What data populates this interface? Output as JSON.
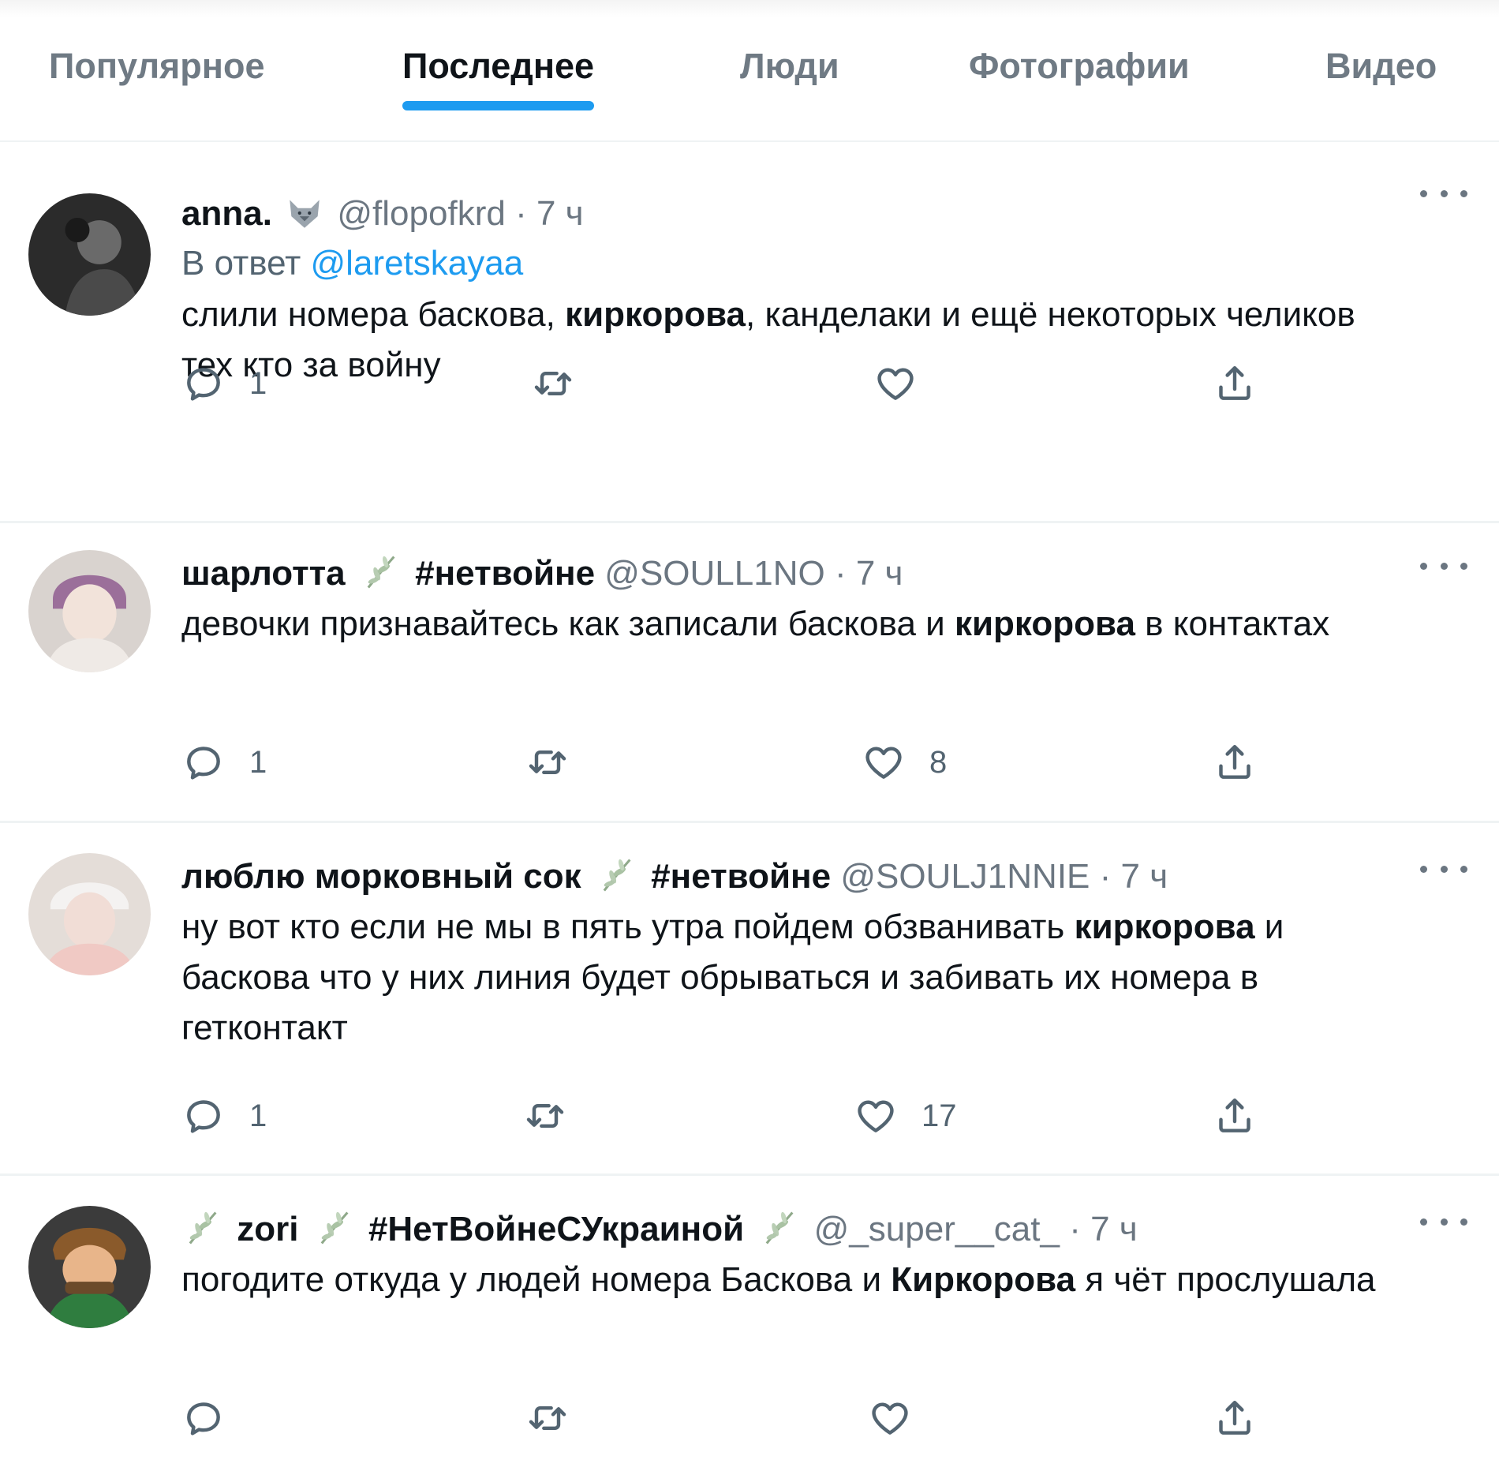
{
  "tabs": [
    {
      "label": "Популярное",
      "active": false
    },
    {
      "label": "Последнее",
      "active": true
    },
    {
      "label": "Люди",
      "active": false
    },
    {
      "label": "Фотографии",
      "active": false
    },
    {
      "label": "Видео",
      "active": false
    }
  ],
  "colors": {
    "accent": "#1d9bf0",
    "secondary_text": "#536471",
    "primary_text": "#0f1419",
    "divider": "#eff3f4"
  },
  "icons": {
    "reply": "reply-icon",
    "retweet": "retweet-icon",
    "like": "heart-icon",
    "share": "share-icon",
    "more": "more-icon",
    "plant": "plant-icon",
    "fox": "fox-emoji-icon"
  },
  "tweets": [
    {
      "name": "anna.",
      "handle": "@flopofkrd",
      "dot": "·",
      "time": "7 ч",
      "reply_prefix": "В ответ",
      "reply_to": "@laretskayaa",
      "text_a": "слили номера баскова, ",
      "text_bold": "киркорова",
      "text_b": ", канделаки и ещё некоторых челиков тех кто за войну",
      "reply_count": "1",
      "retweet_count": "",
      "like_count": ""
    },
    {
      "name": "шарлотта",
      "tag": "#нетвойне",
      "handle": "@SOULL1NO",
      "dot": "·",
      "time": "7 ч",
      "text_a": "девочки признавайтесь как записали баскова и ",
      "text_bold": "киркорова",
      "text_b": " в контактах",
      "reply_count": "1",
      "retweet_count": "",
      "like_count": "8"
    },
    {
      "name": "люблю морковный сок",
      "tag": "#нетвойне",
      "handle": "@SOULJ1NNIE",
      "dot": "·",
      "time": "7 ч",
      "text_a": "ну вот кто если не мы в пять утра пойдем обзванивать ",
      "text_bold": "киркорова",
      "text_b": " и баскова что у них линия будет обрываться и забивать их номера в гетконтакт",
      "reply_count": "1",
      "retweet_count": "",
      "like_count": "17"
    },
    {
      "name": "zori",
      "tag": "#НетВойнеСУкраиной",
      "handle": "@_super__cat_",
      "dot": "·",
      "time": "7 ч",
      "text_a": "погодите откуда у людей номера Баскова и ",
      "text_bold": "Киркорова",
      "text_b": " я чёт прослушала",
      "reply_count": "",
      "retweet_count": "",
      "like_count": ""
    }
  ]
}
